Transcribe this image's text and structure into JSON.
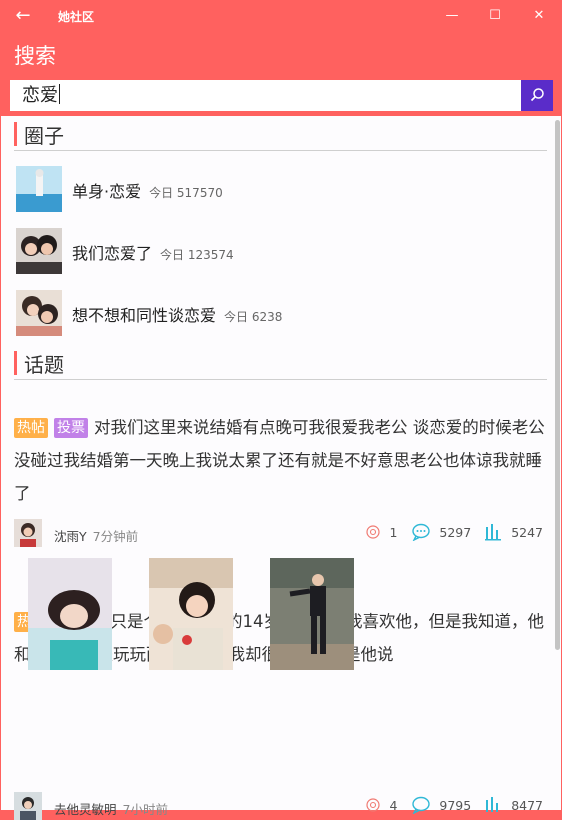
{
  "window": {
    "back_glyph": "←",
    "app_title": "她社区",
    "minimize": "—",
    "maximize": "☐",
    "close": "✕"
  },
  "page": {
    "title": "搜索"
  },
  "search": {
    "value": "恋爱"
  },
  "sections": {
    "circles": "圈子",
    "topics": "话题"
  },
  "circles": [
    {
      "name": "单身·恋爱",
      "today": "今日 517570"
    },
    {
      "name": "我们恋爱了",
      "today": "今日 123574"
    },
    {
      "name": "想不想和同性谈恋爱",
      "today": "今日 6238"
    }
  ],
  "posts": [
    {
      "tags": [
        "热帖",
        "投票"
      ],
      "text": "对我们这里来说结婚有点晚可我很爱我老公 谈恋爱的时候老公没碰过我结婚第一天晚上我说太累了还有就是不好意思老公也体谅我就睡了",
      "author": "沈雨Y",
      "time": "7分钟前",
      "likes": "1",
      "comments": "5297",
      "views": "5247"
    },
    {
      "tags": [
        "热帖",
        "投票"
      ],
      "text": "我只是个年少无知的14岁小姑娘，我喜欢他，但是我知道，他和我恋爱只是玩玩而已，但是我却很珍惜。但是他说",
      "author": "去他灵敏明",
      "time": "7小时前",
      "likes": "4",
      "comments": "9795",
      "views": "8477"
    }
  ],
  "colors": {
    "accent": "#ff615f",
    "search_button": "#5a2cc9",
    "hot_tag": "#ffb049",
    "vote_tag": "#c181e8",
    "stat_icon": "#2fb8d6"
  }
}
